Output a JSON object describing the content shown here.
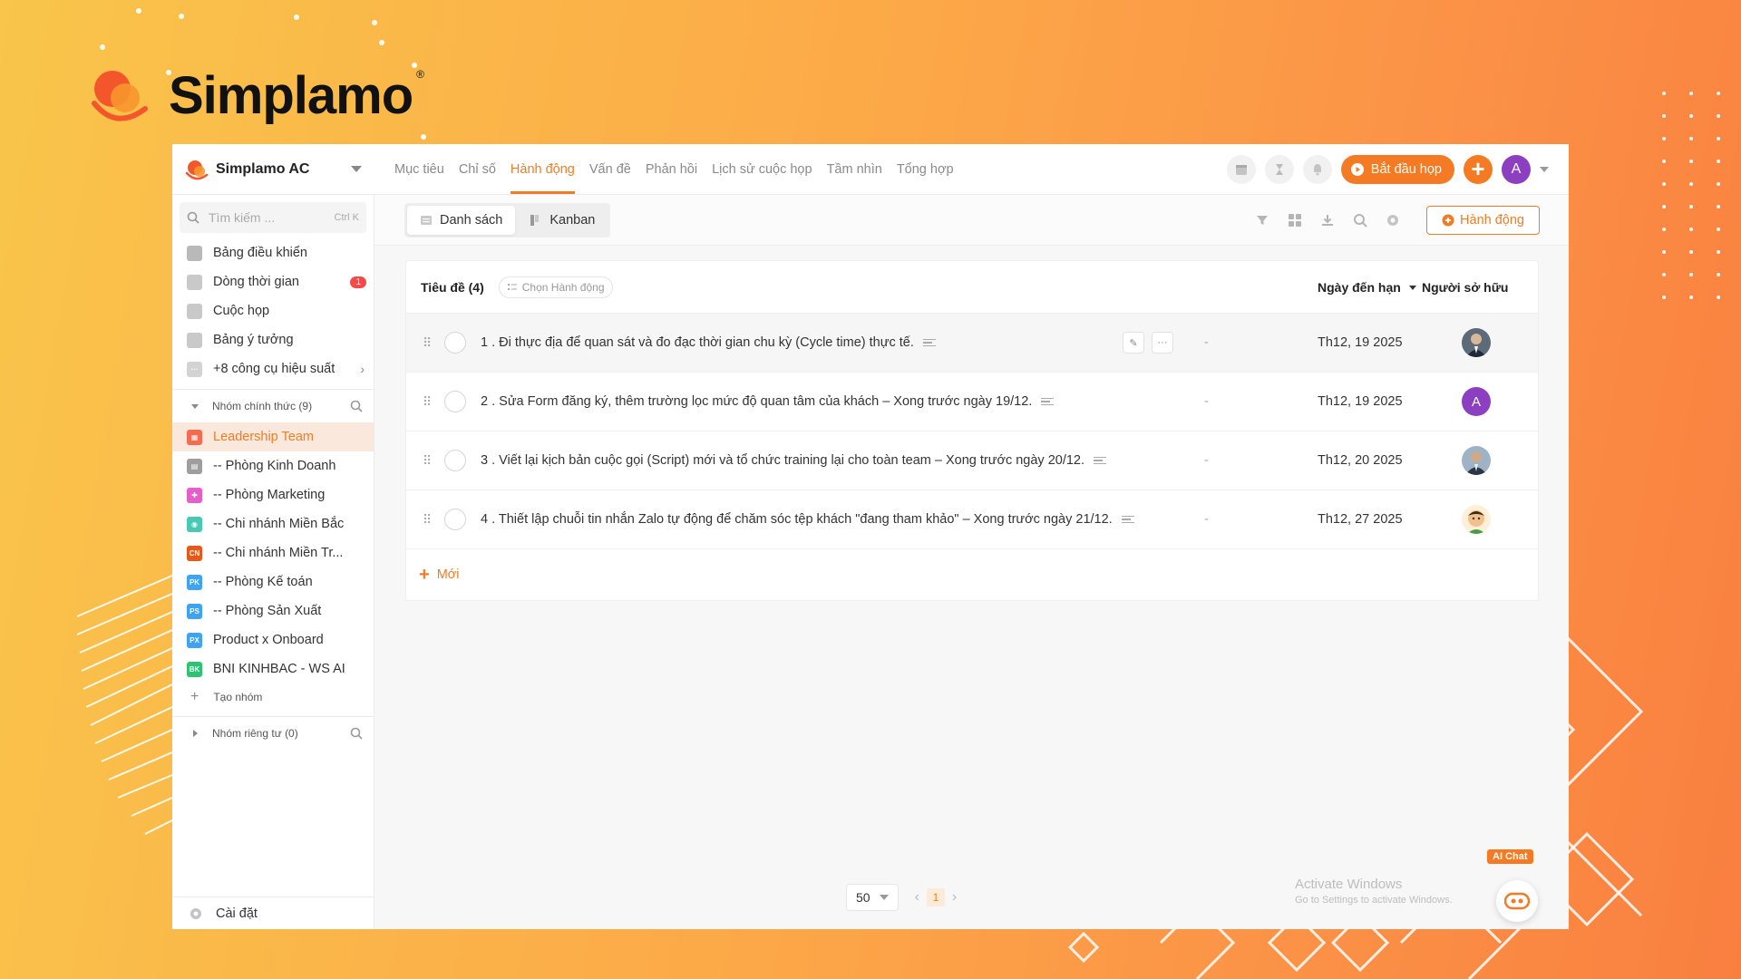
{
  "brand": {
    "name": "Simplamo",
    "reg": "®"
  },
  "header": {
    "workspace": "Simplamo AC",
    "tabs": [
      {
        "label": "Mục tiêu",
        "active": false
      },
      {
        "label": "Chỉ số",
        "active": false
      },
      {
        "label": "Hành động",
        "active": true
      },
      {
        "label": "Vấn đề",
        "active": false
      },
      {
        "label": "Phản hồi",
        "active": false
      },
      {
        "label": "Lịch sử cuộc họp",
        "active": false
      },
      {
        "label": "Tầm nhìn",
        "active": false
      },
      {
        "label": "Tổng hợp",
        "active": false
      }
    ],
    "start_meeting": "Bắt đầu họp",
    "user_initial": "A"
  },
  "sidebar": {
    "search_placeholder": "Tìm kiếm ...",
    "search_shortcut": "Ctrl K",
    "items": [
      {
        "label": "Bảng điều khiển",
        "icon": "dashboard-icon"
      },
      {
        "label": "Dòng thời gian",
        "icon": "timeline-icon",
        "badge": "1"
      },
      {
        "label": "Cuộc họp",
        "icon": "calendar-icon"
      },
      {
        "label": "Bảng ý tưởng",
        "icon": "idea-board-icon"
      },
      {
        "label": "+8 công cụ hiệu suất",
        "icon": "more-tools-icon"
      }
    ],
    "official_groups": "Nhóm chính thức (9)",
    "groups": [
      {
        "label": "Leadership Team",
        "abbr": "",
        "color": "#f36c52",
        "selected": true
      },
      {
        "label": "-- Phòng Kinh Doanh",
        "abbr": "",
        "color": "#9e9e9e"
      },
      {
        "label": "-- Phòng Marketing",
        "abbr": "",
        "color": "#e45fc9"
      },
      {
        "label": "-- Chi nhánh Miền Bắc",
        "abbr": "",
        "color": "#49c9b4"
      },
      {
        "label": "-- Chi nhánh Miền Tr...",
        "abbr": "CN",
        "color": "#e7581b"
      },
      {
        "label": "-- Phòng Kế toán",
        "abbr": "PK",
        "color": "#3da3f2"
      },
      {
        "label": "-- Phòng Sản Xuất",
        "abbr": "PS",
        "color": "#3da3f2"
      },
      {
        "label": "Product x Onboard",
        "abbr": "PX",
        "color": "#3da3f2"
      },
      {
        "label": "BNI KINHBAC - WS AI",
        "abbr": "BK",
        "color": "#2fc273"
      }
    ],
    "create_group": "Tạo nhóm",
    "private_groups": "Nhóm riêng tư (0)",
    "settings": "Cài đặt"
  },
  "toolbar": {
    "view_list": "Danh sách",
    "view_kanban": "Kanban",
    "add_action": "Hành động"
  },
  "table": {
    "title_header": "Tiêu đề (4)",
    "choose_action": "Chọn Hành động",
    "due_header": "Ngày đến hạn",
    "owner_header": "Người sở hữu",
    "rows": [
      {
        "title": "1 . Đi thực địa để quan sát và đo đạc thời gian chu kỳ (Cycle time) thực tế.",
        "dash": "-",
        "due": "Th12, 19 2025",
        "owner": "photo-avatar"
      },
      {
        "title": "2 . Sửa Form đăng ký, thêm trường lọc mức độ quan tâm của khách – Xong trước ngày 19/12.",
        "dash": "-",
        "due": "Th12, 19 2025",
        "owner": "A"
      },
      {
        "title": "3 . Viết lại kịch bản cuộc gọi (Script) mới và tổ chức training lại cho toàn team – Xong trước ngày 20/12.",
        "dash": "-",
        "due": "Th12, 20 2025",
        "owner": "photo-avatar"
      },
      {
        "title": "4 . Thiết lập chuỗi tin nhắn Zalo tự động để chăm sóc tệp khách \"đang tham khảo\" – Xong trước ngày 21/12.",
        "dash": "-",
        "due": "Th12, 27 2025",
        "owner": "cartoon-avatar"
      }
    ],
    "new_label": "Mới"
  },
  "pagination": {
    "page_size": "50",
    "current_page": "1"
  },
  "watermark": {
    "line1": "Activate Windows",
    "line2": "Go to Settings to activate Windows."
  },
  "ai_chat": "AI Chat",
  "colors": {
    "accent": "#f07c25",
    "purple": "#8c3fc0"
  }
}
